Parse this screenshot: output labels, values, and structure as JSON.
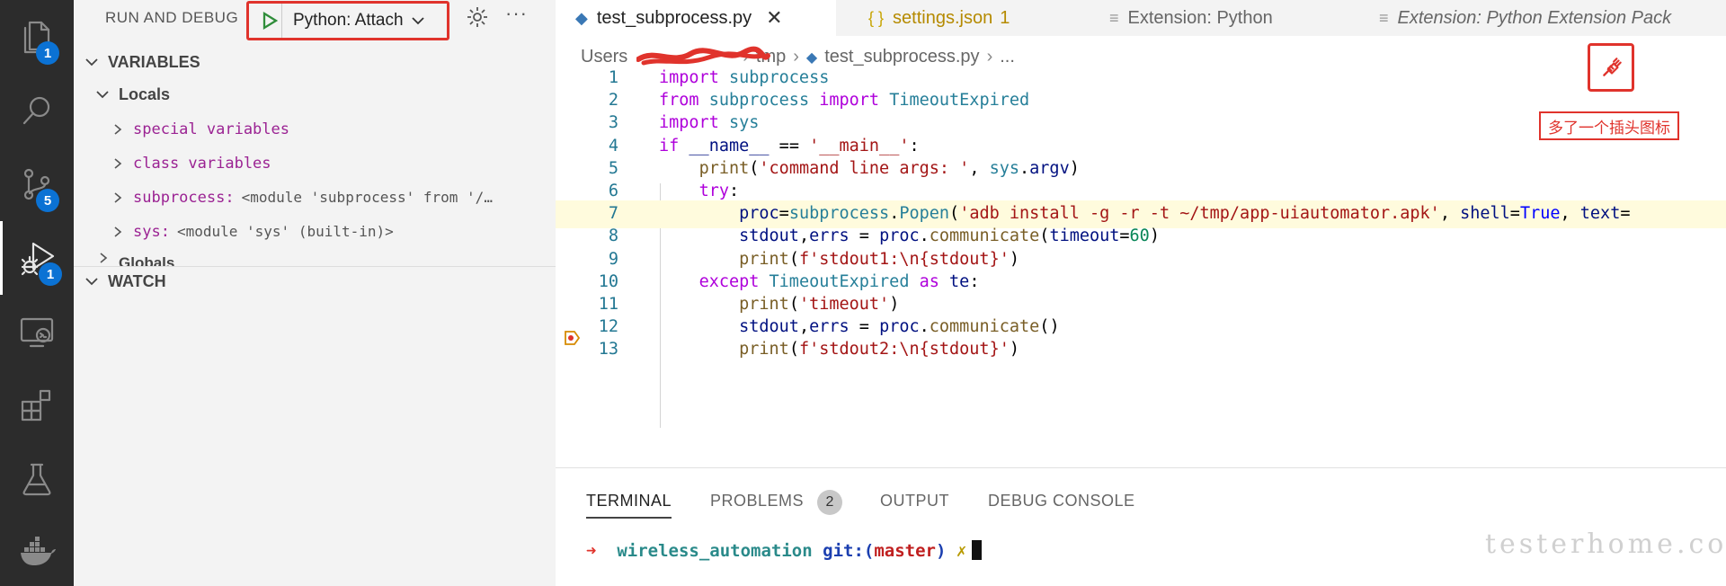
{
  "activity_bar": {
    "items": [
      {
        "icon": "files-icon",
        "badge": "1"
      },
      {
        "icon": "search-icon",
        "badge": ""
      },
      {
        "icon": "source-control-icon",
        "badge": "5"
      },
      {
        "icon": "run-debug-icon",
        "badge": "1",
        "active": true
      },
      {
        "icon": "remote-explorer-icon",
        "badge": ""
      },
      {
        "icon": "extensions-icon",
        "badge": ""
      },
      {
        "icon": "testing-icon",
        "badge": ""
      },
      {
        "icon": "docker-icon",
        "badge": ""
      }
    ]
  },
  "sidebar": {
    "title": "RUN AND DEBUG",
    "config": "Python: Attach",
    "variables_header": "VARIABLES",
    "locals_label": "Locals",
    "variables": [
      {
        "name": "special variables",
        "value": ""
      },
      {
        "name": "class variables",
        "value": ""
      },
      {
        "name": "subprocess:",
        "value": "<module 'subprocess' from '/…"
      },
      {
        "name": "sys:",
        "value": "<module 'sys' (built-in)>"
      }
    ],
    "globals_label": "Globals",
    "watch_header": "WATCH"
  },
  "tabs": [
    {
      "label": "test_subprocess.py",
      "icon": "python-icon",
      "active": true,
      "suffix": ""
    },
    {
      "label": "settings.json",
      "icon": "json-braces-icon",
      "active": false,
      "suffix": "1"
    },
    {
      "label": "Extension: Python",
      "icon": "preview-icon",
      "active": false,
      "suffix": ""
    },
    {
      "label": "Extension: Python Extension Pack",
      "icon": "preview-icon",
      "active": false,
      "suffix": ""
    }
  ],
  "breadcrumb": {
    "root": "Users",
    "folder": "tmp",
    "file": "test_subprocess.py",
    "tail": "..."
  },
  "code": {
    "current_line": 7,
    "lines": [
      "import subprocess",
      "from subprocess import TimeoutExpired",
      "import sys",
      "if __name__ == '__main__':",
      "    print('command line args: ', sys.argv)",
      "    try:",
      "        proc=subprocess.Popen('adb install -g -r -t ~/tmp/app-uiautomator.apk', shell=True, text=",
      "        stdout,errs = proc.communicate(timeout=60)",
      "        print(f'stdout1:\\n{stdout}')",
      "    except TimeoutExpired as te:",
      "        print('timeout')",
      "        stdout,errs = proc.communicate()",
      "        print(f'stdout2:\\n{stdout}')"
    ]
  },
  "debug_toolbar": {
    "buttons": [
      "continue-icon",
      "step-over-icon",
      "step-into-icon",
      "step-out-icon",
      "restart-icon",
      "disconnect-plug-icon"
    ],
    "annotation": "多了一个插头图标"
  },
  "panel": {
    "tabs": [
      "TERMINAL",
      "PROBLEMS",
      "OUTPUT",
      "DEBUG CONSOLE"
    ],
    "problems_count": "2",
    "terminal": {
      "prompt": "➜",
      "dir": "wireless_automation",
      "git": "git:(",
      "branch": "master",
      "git_close": ")",
      "dirty": "✗"
    }
  },
  "watermark": "testerhome.com",
  "colors": {
    "accent_red": "#e0332c",
    "badge_blue": "#0b72d4",
    "debug_blue": "#1a85ff",
    "debug_green": "#2f8d3a"
  }
}
